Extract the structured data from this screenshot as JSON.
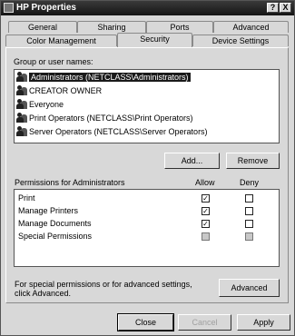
{
  "window": {
    "title": "HP Properties",
    "help_btn": "?",
    "close_btn": "X"
  },
  "tabs_row1": [
    {
      "label": "General"
    },
    {
      "label": "Sharing"
    },
    {
      "label": "Ports"
    },
    {
      "label": "Advanced"
    }
  ],
  "tabs_row2": [
    {
      "label": "Color Management"
    },
    {
      "label": "Security"
    },
    {
      "label": "Device Settings"
    }
  ],
  "security": {
    "group_label": "Group or user names:",
    "users": [
      {
        "name": "Administrators (NETCLASS\\Administrators)",
        "selected": true
      },
      {
        "name": "CREATOR OWNER",
        "selected": false
      },
      {
        "name": "Everyone",
        "selected": false
      },
      {
        "name": "Print Operators (NETCLASS\\Print Operators)",
        "selected": false
      },
      {
        "name": "Server Operators (NETCLASS\\Server Operators)",
        "selected": false
      }
    ],
    "add_label": "Add...",
    "remove_label": "Remove",
    "permissions_label": "Permissions for Administrators",
    "allow_label": "Allow",
    "deny_label": "Deny",
    "permissions": [
      {
        "name": "Print",
        "allow": true,
        "deny": false,
        "greyed": false
      },
      {
        "name": "Manage Printers",
        "allow": true,
        "deny": false,
        "greyed": false
      },
      {
        "name": "Manage Documents",
        "allow": true,
        "deny": false,
        "greyed": false
      },
      {
        "name": "Special Permissions",
        "allow": false,
        "deny": false,
        "greyed": true
      }
    ],
    "advanced_note": "For special permissions or for advanced settings, click Advanced.",
    "advanced_label": "Advanced"
  },
  "footer": {
    "close_label": "Close",
    "cancel_label": "Cancel",
    "apply_label": "Apply"
  }
}
